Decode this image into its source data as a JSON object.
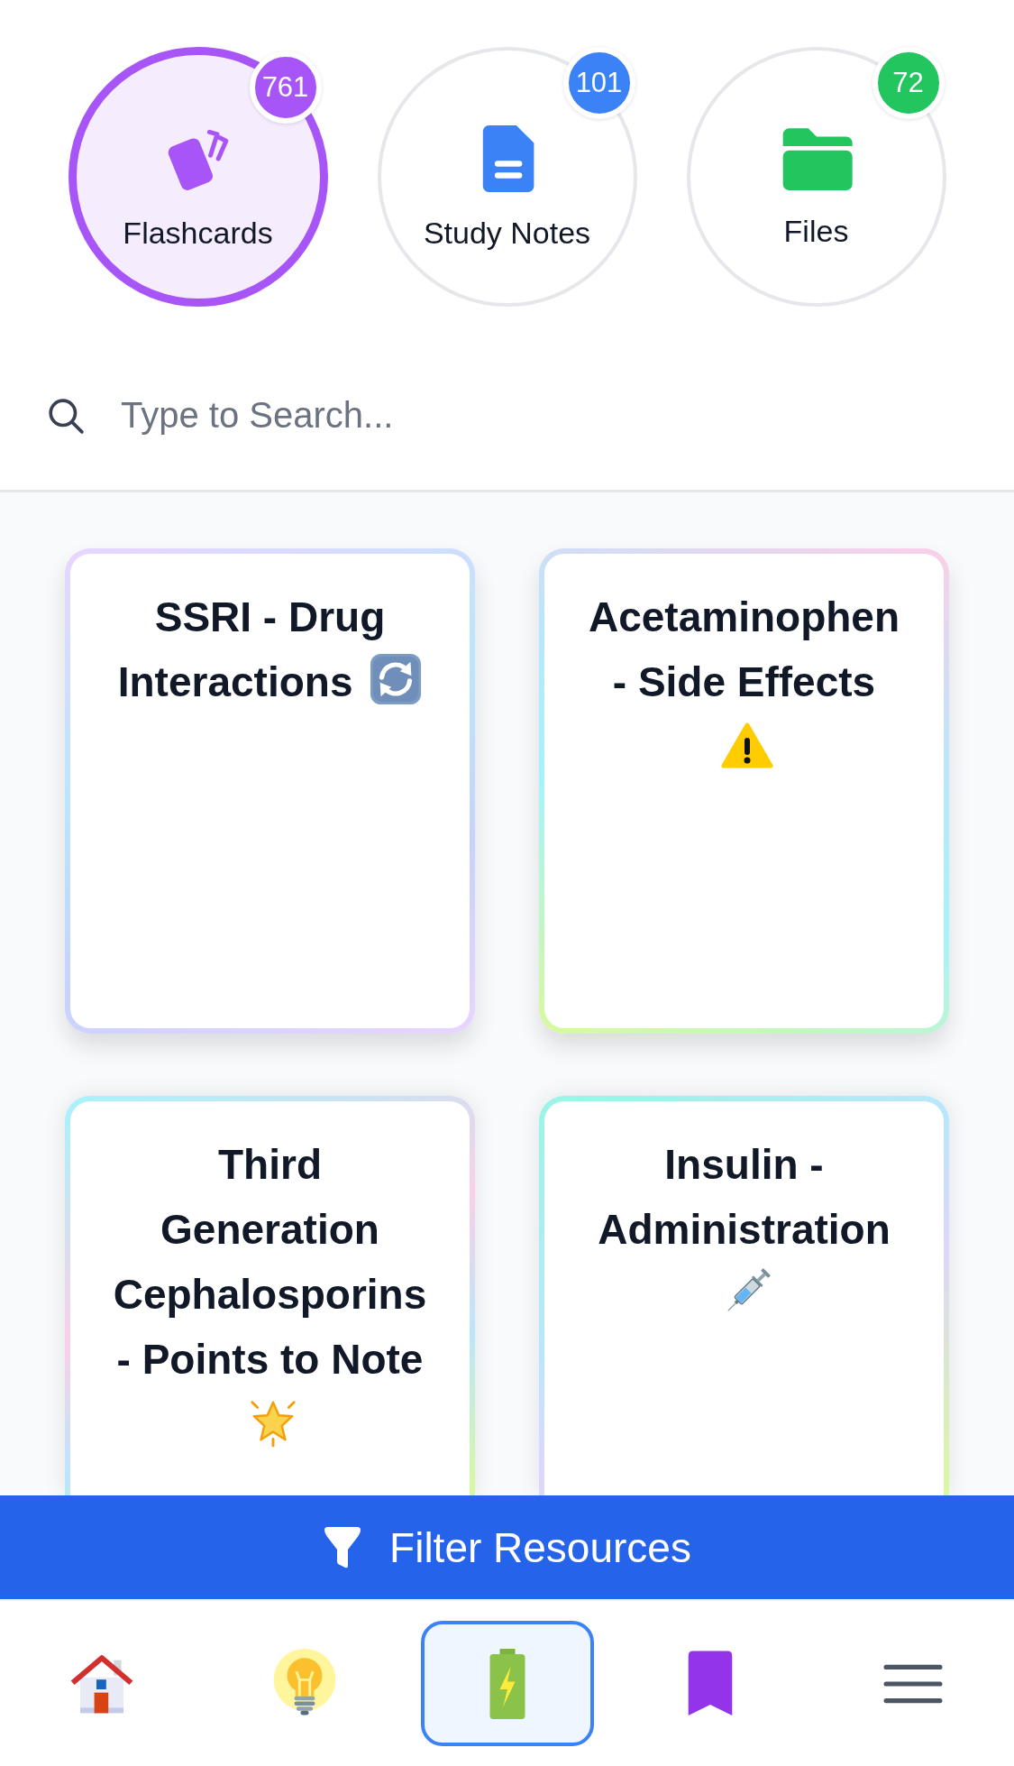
{
  "categories": [
    {
      "kind": "flashcards",
      "label": "Flashcards",
      "count": "761",
      "color": "#a855f7",
      "selected": true
    },
    {
      "kind": "notes",
      "label": "Study Notes",
      "count": "101",
      "color": "#3b82f6",
      "selected": false
    },
    {
      "kind": "files",
      "label": "Files",
      "count": "72",
      "color": "#22c55e",
      "selected": false
    }
  ],
  "search": {
    "placeholder": "Type to Search..."
  },
  "cards": [
    {
      "title": "SSRI - Drug Interactions"
    },
    {
      "title": "Acetaminophen - Side Effects"
    },
    {
      "title": "Third Generation Cephalosporins - Points to Note"
    },
    {
      "title": "Insulin - Administration"
    }
  ],
  "filter_button": {
    "label": "Filter Resources"
  },
  "nav": {
    "items": [
      {
        "kind": "home",
        "selected": false
      },
      {
        "kind": "bulb",
        "selected": false
      },
      {
        "kind": "battery",
        "selected": true
      },
      {
        "kind": "bookmark",
        "selected": false
      },
      {
        "kind": "menu",
        "selected": false
      }
    ]
  }
}
